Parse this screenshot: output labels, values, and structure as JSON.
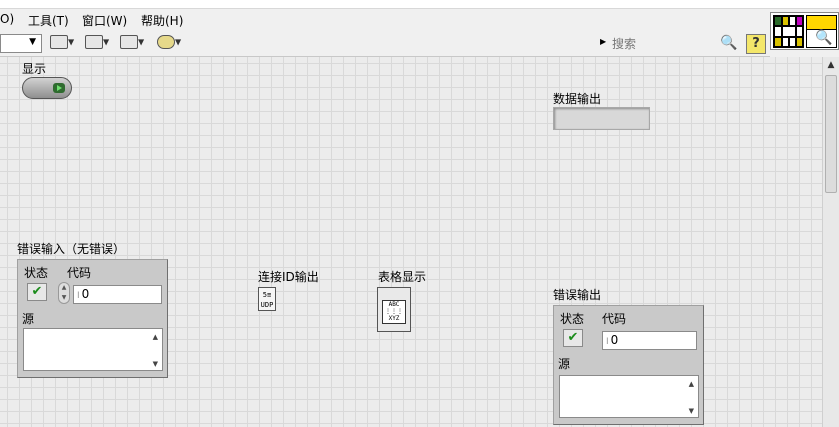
{
  "menubar": {
    "partial_item": "O)",
    "tools": "工具(T)",
    "window": "窗口(W)",
    "help": "帮助(H)"
  },
  "toolbar": {
    "search_placeholder": "搜索",
    "help_label": "?"
  },
  "panel": {
    "display_label": "显示",
    "data_output_label": "数据输出",
    "error_in": {
      "title": "错误输入（无错误）",
      "status_label": "状态",
      "code_label": "代码",
      "code_value": "0",
      "source_label": "源"
    },
    "connection_id_label": "连接ID输出",
    "table_display_label": "表格显示",
    "error_out": {
      "title": "错误输出",
      "status_label": "状态",
      "code_label": "代码",
      "code_value": "0",
      "source_label": "源"
    }
  },
  "icons": {
    "connection_term": "udp-connection-icon",
    "table_term": "table-icon",
    "check": "checkmark-icon",
    "search": "magnifier-icon"
  }
}
